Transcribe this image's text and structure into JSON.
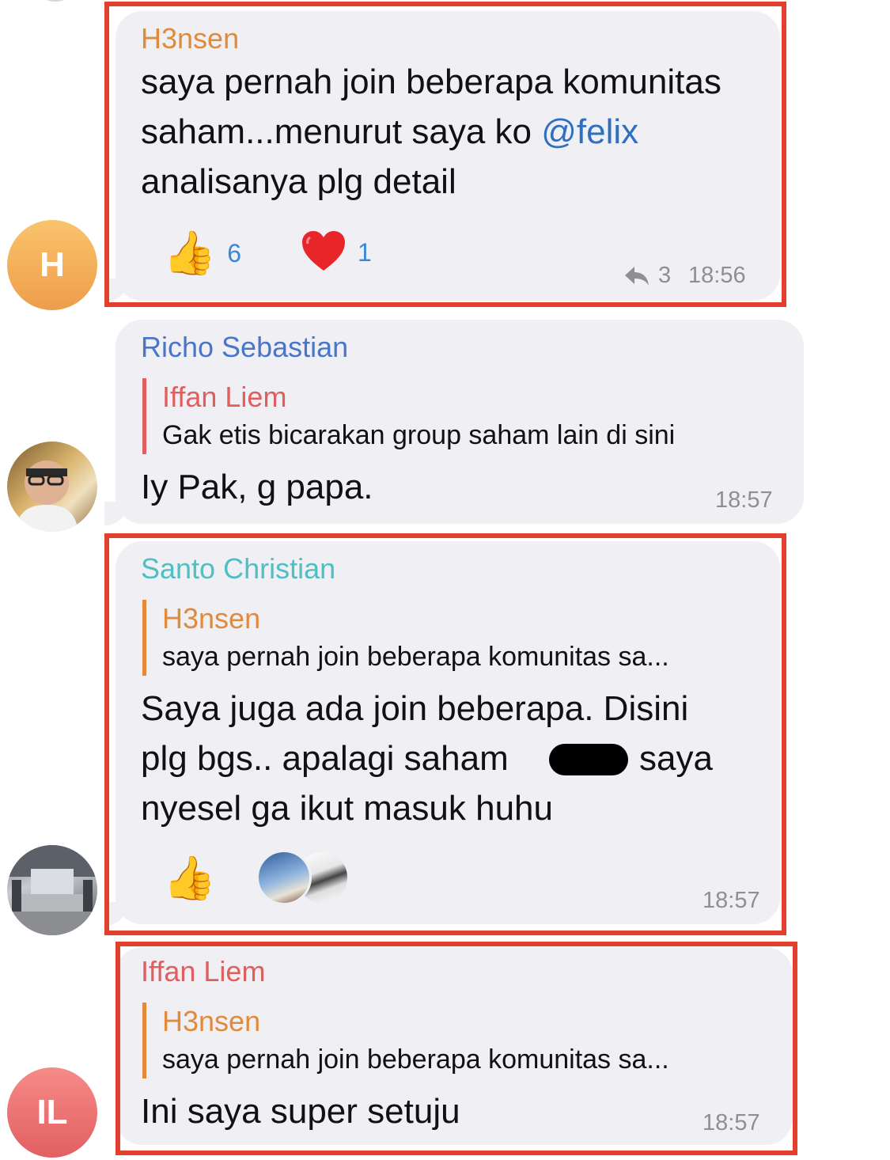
{
  "messages": [
    {
      "avatar_initial": "H",
      "sender": "H3nsen",
      "sender_color": "#e08a3c",
      "text_before": "saya pernah join beberapa komunitas saham...menurut saya ko",
      "mention": "@felix",
      "text_after": " analisanya plg detail",
      "reactions": [
        {
          "icon": "thumbs-up-icon",
          "count": "6"
        },
        {
          "icon": "heart-icon",
          "count": "1"
        }
      ],
      "reply_count": "3",
      "time": "18:56"
    },
    {
      "sender": "Richo Sebastian",
      "sender_color": "#4a76c9",
      "reply_to": {
        "name": "Iffan Liem",
        "text": "Gak etis bicarakan group saham lain di sini",
        "color": "#e05e5e"
      },
      "text": "Iy Pak, g papa.",
      "time": "18:57"
    },
    {
      "sender": "Santo Christian",
      "sender_color": "#4fbfc3",
      "reply_to": {
        "name": "H3nsen",
        "text": "saya pernah join beberapa komunitas sa...",
        "color": "#e08a3c"
      },
      "text_line1": "Saya juga ada join beberapa. Disini",
      "text_line2a": "plg bgs.. apalagi saham",
      "text_line2b": "saya",
      "text_line3": "nyesel ga ikut masuk huhu",
      "time": "18:57"
    },
    {
      "avatar_initial": "IL",
      "sender": "Iffan Liem",
      "sender_color": "#e05e5e",
      "reply_to": {
        "name": "H3nsen",
        "text": "saya pernah join beberapa komunitas sa...",
        "color": "#e08a3c"
      },
      "text": "Ini saya super setuju",
      "time": "18:57"
    }
  ],
  "colors": {
    "highlight_frame": "#e2402c",
    "bubble": "#efeff4",
    "mention": "#2f6fc0"
  }
}
